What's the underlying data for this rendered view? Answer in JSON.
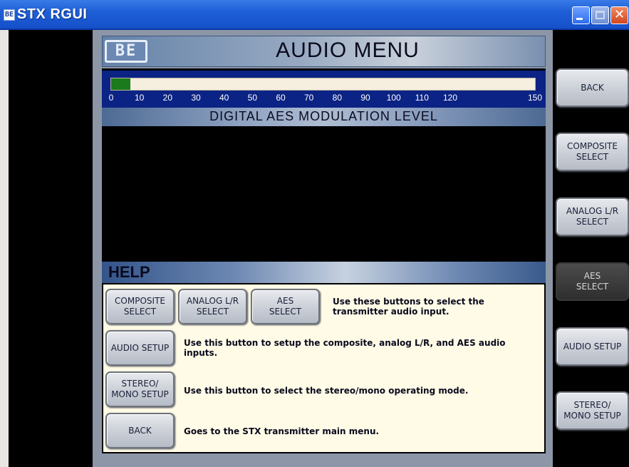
{
  "window": {
    "title": "STX RGUI",
    "app_icon_label": "BE",
    "minimize_icon": "minimize-icon",
    "maximize_icon": "maximize-icon",
    "close_icon": "close-icon",
    "close_glyph": "✕"
  },
  "header": {
    "logo_text": "BE",
    "title": "AUDIO MENU"
  },
  "meter": {
    "label": "DIGITAL AES MODULATION LEVEL",
    "ticks": [
      "0",
      "10",
      "20",
      "30",
      "40",
      "50",
      "60",
      "70",
      "80",
      "90",
      "100",
      "110",
      "120",
      "150"
    ],
    "level_fraction": 0.07,
    "fill_color": "#1b7a1b"
  },
  "help": {
    "title": "HELP",
    "composite_select": "COMPOSITE\nSELECT",
    "analog_select": "ANALOG L/R\nSELECT",
    "aes_select": "AES\nSELECT",
    "select_text": "Use these buttons to select the transmitter audio input.",
    "audio_setup": "AUDIO SETUP",
    "audio_setup_text": "Use this button to setup the composite, analog L/R, and AES audio inputs.",
    "stereo_mono_setup": "STEREO/\nMONO SETUP",
    "stereo_mono_text": "Use this button to select the stereo/mono operating mode.",
    "back": "BACK",
    "back_text": "Goes to the STX transmitter main menu."
  },
  "side_menu": {
    "back": "BACK",
    "composite_select": "COMPOSITE\nSELECT",
    "analog_select": "ANALOG L/R\nSELECT",
    "aes_select": "AES\nSELECT",
    "audio_setup": "AUDIO SETUP",
    "stereo_mono_setup": "STEREO/\nMONO SETUP"
  }
}
